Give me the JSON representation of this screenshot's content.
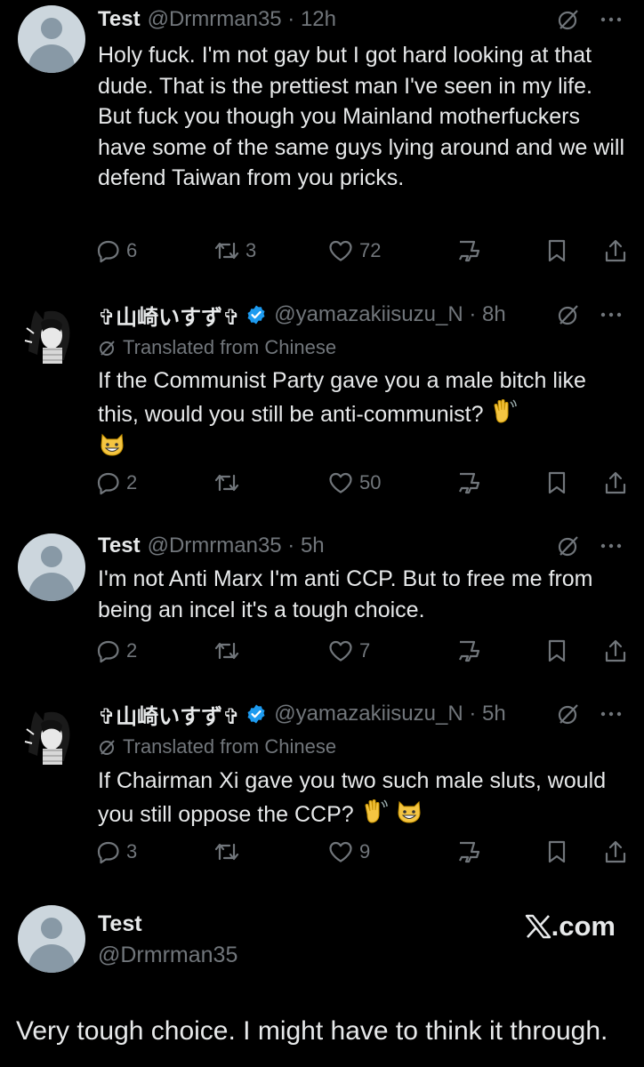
{
  "tweets": [
    {
      "display_name": "Test",
      "handle_time": "@Drmrman35 · 12h",
      "verified": false,
      "translated_label": "",
      "text": "Holy fuck. I'm not gay but I got hard looking at that dude. That is the prettiest man I've seen in my life. But fuck you though you Mainland motherfuckers have some of the same guys lying around and we will defend Taiwan from you pricks.",
      "emoji_line": "",
      "replies": "6",
      "retweets": "3",
      "likes": "72"
    },
    {
      "display_name": "✞山崎いすず✞",
      "handle_time": "@yamazakiisuzu_N · 8h",
      "verified": true,
      "translated_label": "Translated from Chinese",
      "text": "If the Communist Party gave you a male bitch like this, would you still be anti-communist?",
      "emoji_line": "",
      "replies": "2",
      "retweets": "",
      "likes": "50"
    },
    {
      "display_name": "Test",
      "handle_time": "@Drmrman35 · 5h",
      "verified": false,
      "translated_label": "",
      "text": "I'm not Anti Marx I'm anti CCP. But to free me from being an incel it's a tough choice.",
      "emoji_line": "",
      "replies": "2",
      "retweets": "",
      "likes": "7"
    },
    {
      "display_name": "✞山崎いすず✞",
      "handle_time": "@yamazakiisuzu_N · 5h",
      "verified": true,
      "translated_label": "Translated from Chinese",
      "text": "If Chairman Xi gave you two such male sluts, would you still oppose the CCP?",
      "emoji_line": "",
      "replies": "3",
      "retweets": "",
      "likes": "9"
    }
  ],
  "footer": {
    "display_name": "Test",
    "handle": "@Drmrman35",
    "brand": ".com",
    "text": "Very tough choice. I might have to think it through."
  },
  "colors": {
    "background": "#000000",
    "text": "#e7e9ea",
    "secondary": "#71767b",
    "verified": "#1d9bf0"
  },
  "icons": [
    "reply-icon",
    "retweet-icon",
    "like-icon",
    "views-icon",
    "bookmark-icon",
    "share-icon",
    "grok-icon",
    "more-icon",
    "verified-badge-icon",
    "translate-icon",
    "wave-emoji",
    "grin-cat-emoji"
  ]
}
